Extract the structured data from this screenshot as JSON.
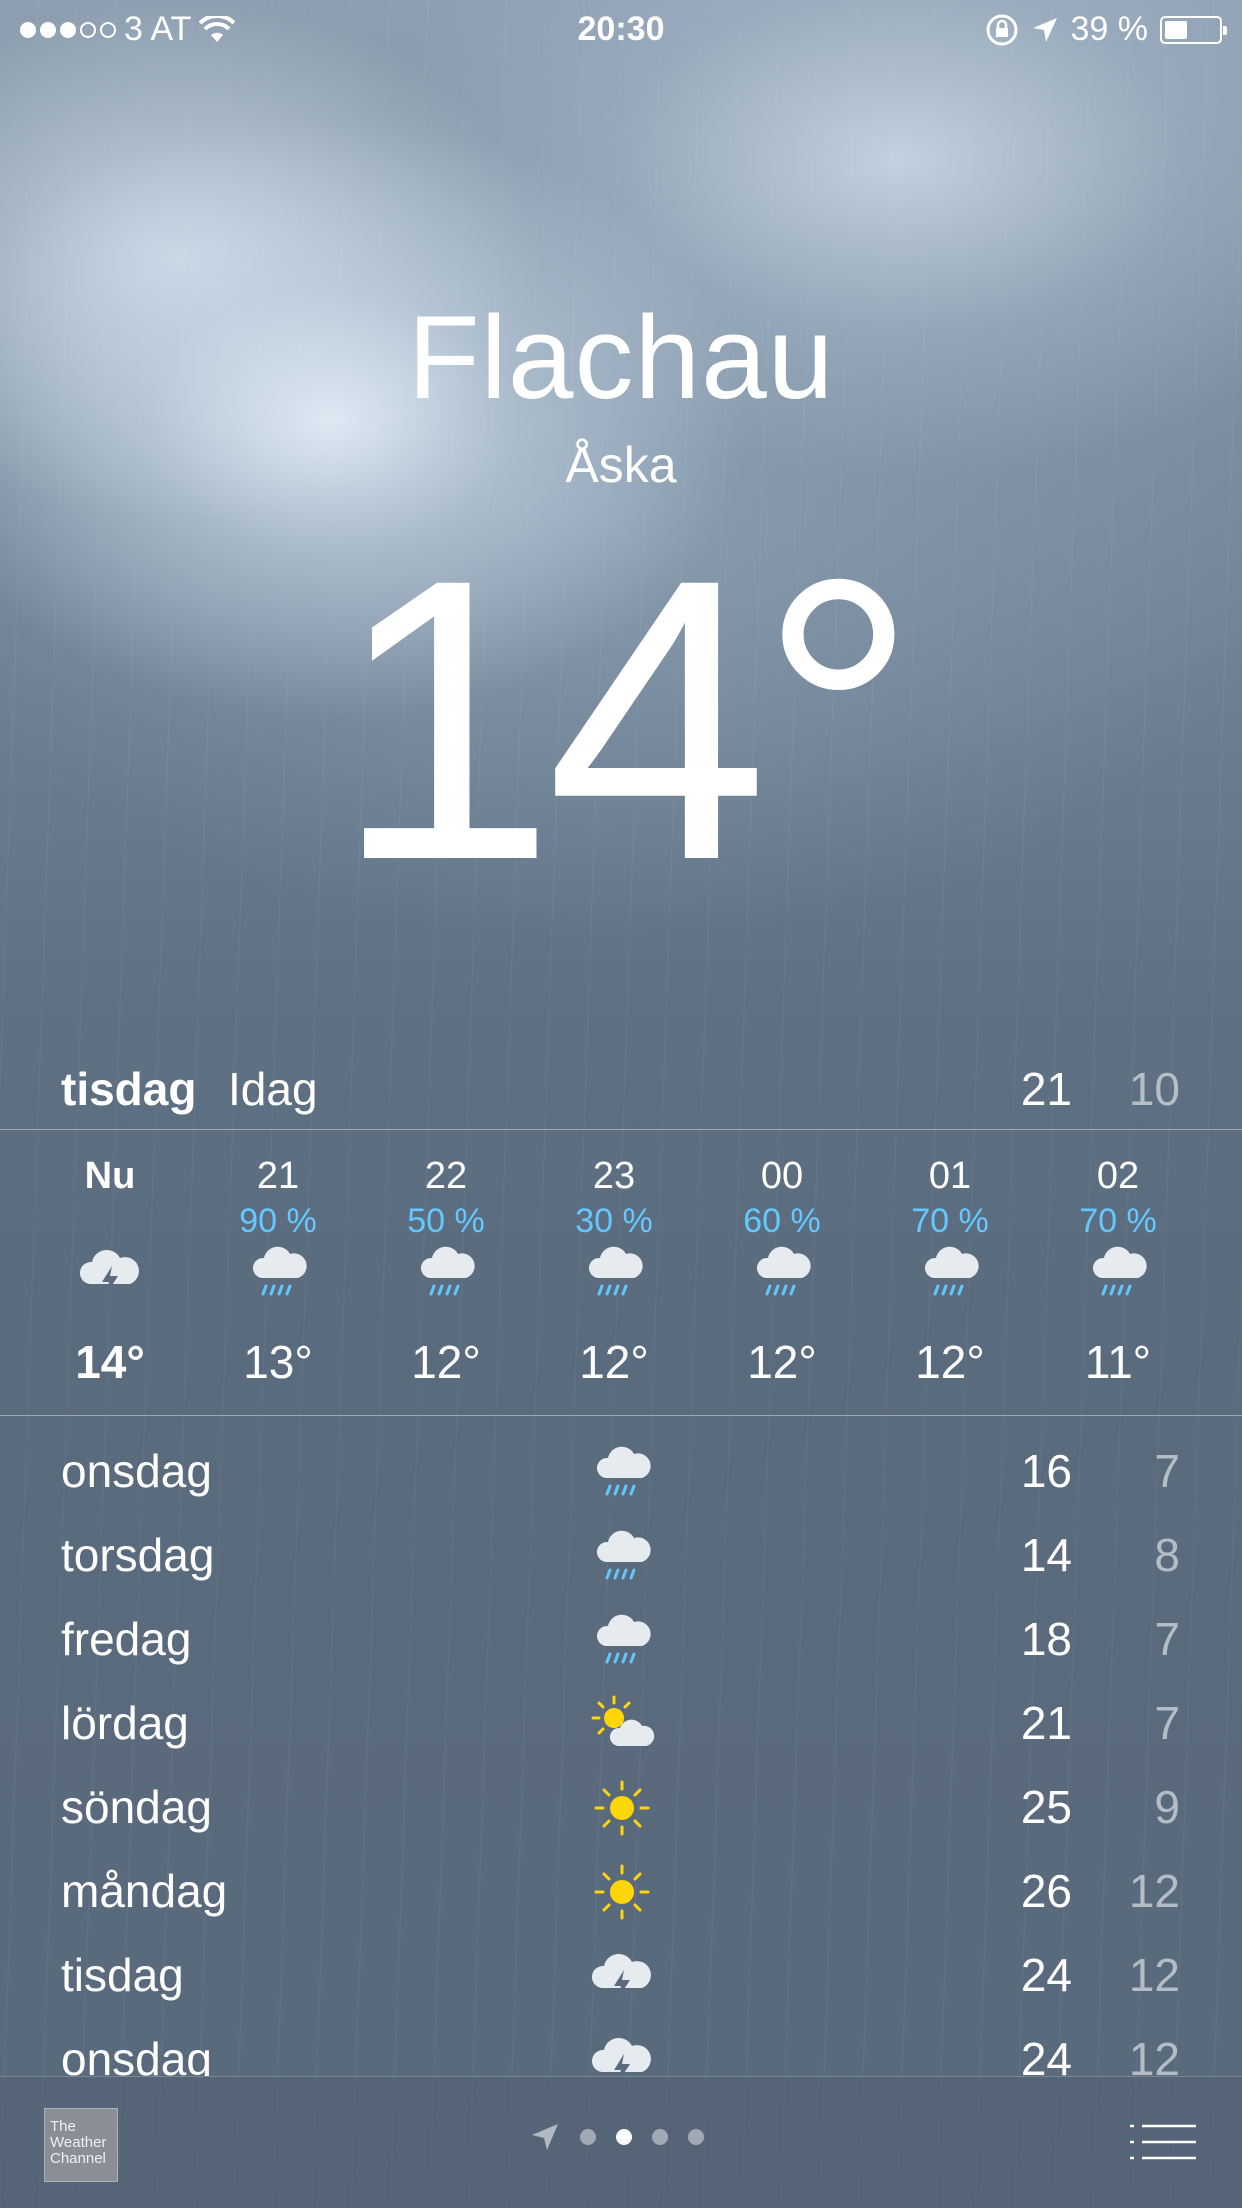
{
  "status_bar": {
    "carrier": "3 AT",
    "time": "20:30",
    "battery": "39 %",
    "battery_level": 0.39,
    "signal_bars": 3
  },
  "current": {
    "city": "Flachau",
    "condition": "Åska",
    "temperature": "14°"
  },
  "today": {
    "day": "tisdag",
    "label": "Idag",
    "high": "21",
    "low": "10"
  },
  "hourly": [
    {
      "time": "Nu",
      "precip": "",
      "icon": "thunderstorm-icon",
      "temp": "14°"
    },
    {
      "time": "21",
      "precip": "90 %",
      "icon": "rain-icon",
      "temp": "13°"
    },
    {
      "time": "22",
      "precip": "50 %",
      "icon": "rain-icon",
      "temp": "12°"
    },
    {
      "time": "23",
      "precip": "30 %",
      "icon": "rain-icon",
      "temp": "12°"
    },
    {
      "time": "00",
      "precip": "60 %",
      "icon": "rain-icon",
      "temp": "12°"
    },
    {
      "time": "01",
      "precip": "70 %",
      "icon": "rain-icon",
      "temp": "12°"
    },
    {
      "time": "02",
      "precip": "70 %",
      "icon": "rain-icon",
      "temp": "11°"
    }
  ],
  "daily": [
    {
      "day": "onsdag",
      "icon": "rain-icon",
      "high": "16",
      "low": "7"
    },
    {
      "day": "torsdag",
      "icon": "rain-icon",
      "high": "14",
      "low": "8"
    },
    {
      "day": "fredag",
      "icon": "rain-icon",
      "high": "18",
      "low": "7"
    },
    {
      "day": "lördag",
      "icon": "partly-sunny-icon",
      "high": "21",
      "low": "7"
    },
    {
      "day": "söndag",
      "icon": "sun-icon",
      "high": "25",
      "low": "9"
    },
    {
      "day": "måndag",
      "icon": "sun-icon",
      "high": "26",
      "low": "12"
    },
    {
      "day": "tisdag",
      "icon": "thunderstorm-icon",
      "high": "24",
      "low": "12"
    },
    {
      "day": "onsdag",
      "icon": "thunderstorm-icon",
      "high": "24",
      "low": "12"
    }
  ],
  "bottom_bar": {
    "logo_text": "The Weather Channel",
    "page_count": 4,
    "active_page": 2
  },
  "colors": {
    "precip": "#64c8ff",
    "sun": "#ffd60a"
  }
}
